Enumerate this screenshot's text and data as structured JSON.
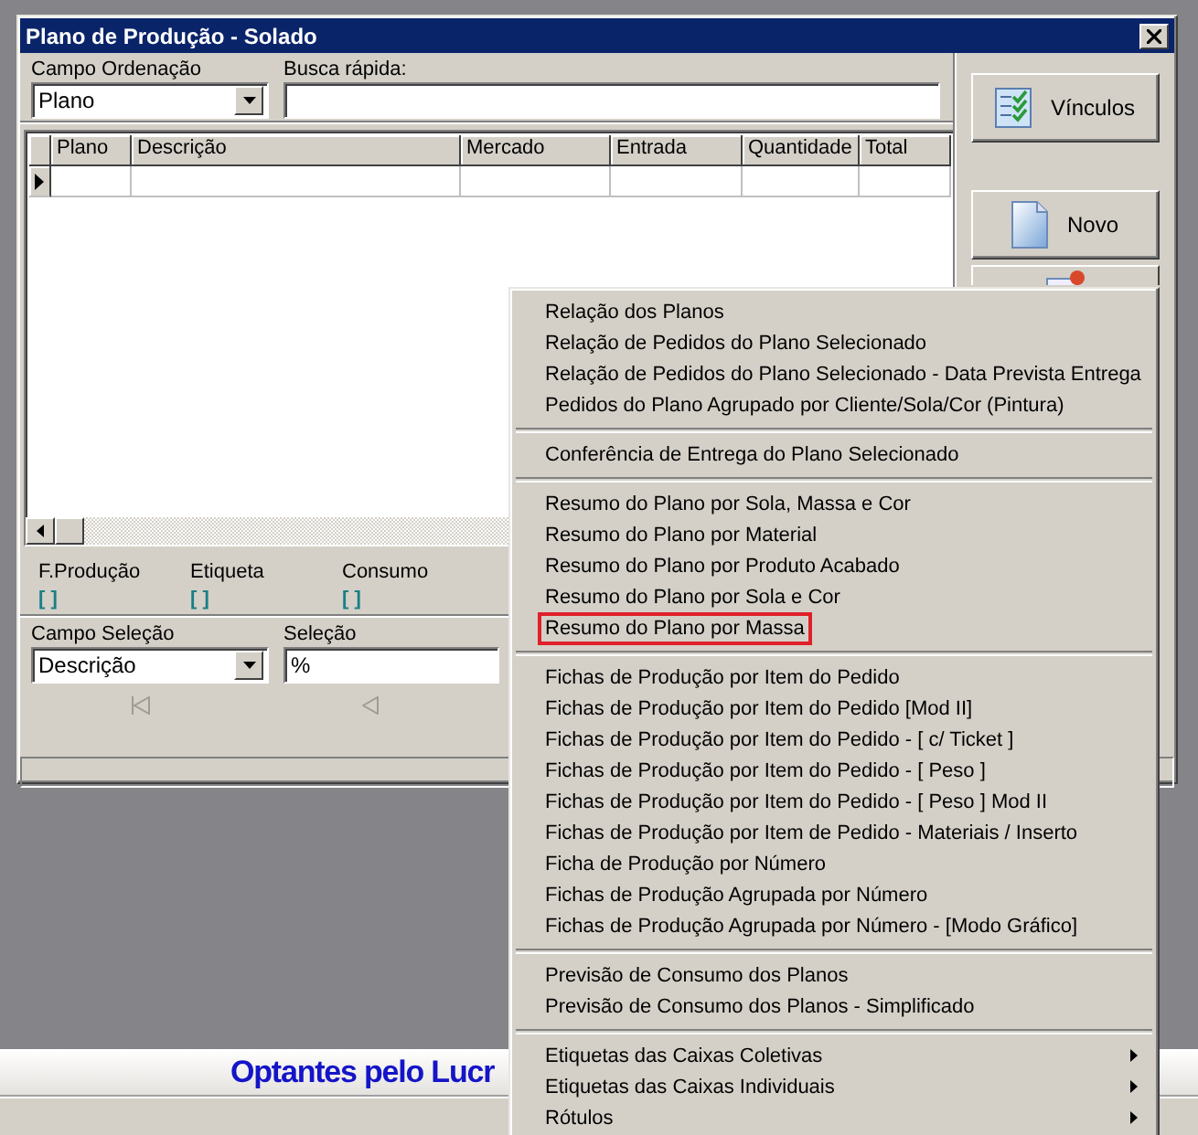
{
  "window": {
    "title": "Plano de Produção - Solado"
  },
  "ordering": {
    "label": "Campo Ordenação",
    "value": "Plano"
  },
  "quick_search": {
    "label": "Busca rápida:"
  },
  "table": {
    "columns": [
      "Plano",
      "Descrição",
      "Mercado",
      "Entrada",
      "Quantidade",
      "Total"
    ]
  },
  "flags": [
    {
      "label": "F.Produção",
      "value": "[ ]"
    },
    {
      "label": "Etiqueta",
      "value": "[ ]"
    },
    {
      "label": "Consumo",
      "value": "[ ]"
    }
  ],
  "selection_field": {
    "label": "Campo Seleção",
    "value": "Descrição"
  },
  "selection": {
    "label": "Seleção",
    "value": "%"
  },
  "nav_buttons": [
    {
      "kind": "first",
      "disabled": true
    },
    {
      "kind": "prior",
      "disabled": true
    }
  ],
  "side_buttons": [
    {
      "kind": "links",
      "label": "Vínculos"
    },
    {
      "kind": "new",
      "label": "Novo"
    },
    {
      "kind": "edit"
    }
  ],
  "banner": {
    "text": "Optantes pelo Lucr"
  },
  "context_menu": [
    {
      "kind": "item",
      "label": "Relação dos Planos",
      "submenu": false,
      "outlined": false
    },
    {
      "kind": "item",
      "label": "Relação de Pedidos do Plano Selecionado",
      "submenu": false,
      "outlined": false
    },
    {
      "kind": "item",
      "label": "Relação de Pedidos do Plano Selecionado - Data Prevista Entrega",
      "submenu": false,
      "outlined": false
    },
    {
      "kind": "item",
      "label": "Pedidos do Plano Agrupado por Cliente/Sola/Cor (Pintura)",
      "submenu": false,
      "outlined": false
    },
    {
      "kind": "separator"
    },
    {
      "kind": "item",
      "label": "Conferência de Entrega do Plano Selecionado",
      "submenu": false,
      "outlined": false
    },
    {
      "kind": "separator"
    },
    {
      "kind": "item",
      "label": "Resumo do Plano por Sola, Massa e Cor",
      "submenu": false,
      "outlined": false
    },
    {
      "kind": "item",
      "label": "Resumo do Plano por Material",
      "submenu": false,
      "outlined": false
    },
    {
      "kind": "item",
      "label": "Resumo do Plano por Produto Acabado",
      "submenu": false,
      "outlined": false
    },
    {
      "kind": "item",
      "label": "Resumo do Plano por Sola e Cor",
      "submenu": false,
      "outlined": false
    },
    {
      "kind": "item",
      "label": "Resumo do Plano por Massa",
      "submenu": false,
      "outlined": true
    },
    {
      "kind": "separator"
    },
    {
      "kind": "item",
      "label": "Fichas de Produção por Item do Pedido",
      "submenu": false,
      "outlined": false
    },
    {
      "kind": "item",
      "label": "Fichas de Produção por Item do Pedido [Mod II]",
      "submenu": false,
      "outlined": false
    },
    {
      "kind": "item",
      "label": "Fichas de Produção por Item do Pedido - [ c/ Ticket ]",
      "submenu": false,
      "outlined": false
    },
    {
      "kind": "item",
      "label": "Fichas de Produção por Item do Pedido - [ Peso ]",
      "submenu": false,
      "outlined": false
    },
    {
      "kind": "item",
      "label": "Fichas de Produção por Item do Pedido - [ Peso ] Mod II",
      "submenu": false,
      "outlined": false
    },
    {
      "kind": "item",
      "label": "Fichas de Produção por Item de Pedido - Materiais / Inserto",
      "submenu": false,
      "outlined": false
    },
    {
      "kind": "item",
      "label": "Ficha de Produção por Número",
      "submenu": false,
      "outlined": false
    },
    {
      "kind": "item",
      "label": "Fichas de Produção Agrupada por Número",
      "submenu": false,
      "outlined": false
    },
    {
      "kind": "item",
      "label": "Fichas de Produção Agrupada por Número - [Modo Gráfico]",
      "submenu": false,
      "outlined": false
    },
    {
      "kind": "separator"
    },
    {
      "kind": "item",
      "label": "Previsão de Consumo dos Planos",
      "submenu": false,
      "outlined": false
    },
    {
      "kind": "item",
      "label": "Previsão de Consumo dos Planos - Simplificado",
      "submenu": false,
      "outlined": false
    },
    {
      "kind": "separator"
    },
    {
      "kind": "item",
      "label": "Etiquetas das Caixas Coletivas",
      "submenu": true,
      "outlined": false
    },
    {
      "kind": "item",
      "label": "Etiquetas das Caixas Individuais",
      "submenu": true,
      "outlined": false
    },
    {
      "kind": "item",
      "label": "Rótulos",
      "submenu": true,
      "outlined": false
    }
  ]
}
